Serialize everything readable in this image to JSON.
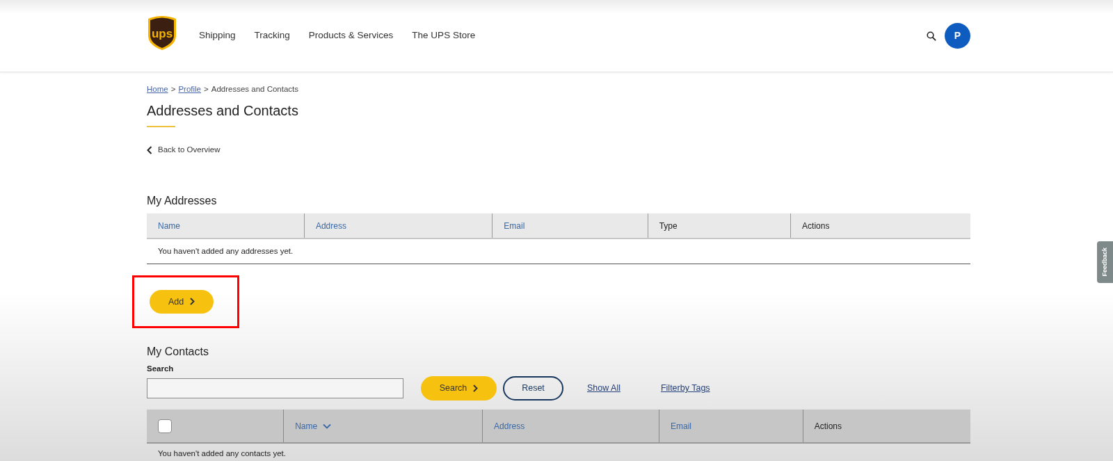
{
  "header": {
    "logo": {
      "text": "ups"
    },
    "nav": [
      "Shipping",
      "Tracking",
      "Products & Services",
      "The UPS Store"
    ],
    "avatar": {
      "initial": "P"
    }
  },
  "breadcrumb": [
    {
      "label": "Home",
      "link": true
    },
    {
      "separator": ">",
      "label": "Profile",
      "link": true
    },
    {
      "separator": ">",
      "label": "Addresses and Contacts",
      "link": false
    }
  ],
  "title": "Addresses and Contacts",
  "back_link": "Back to Overview",
  "addresses": {
    "heading": "My Addresses",
    "columns": [
      {
        "label": "Name",
        "link": true
      },
      {
        "label": "Address",
        "link": true
      },
      {
        "label": "Email",
        "link": true
      },
      {
        "label": "Type",
        "link": false
      },
      {
        "label": "Actions",
        "link": false
      }
    ],
    "empty_text": "You haven't added any addresses yet.",
    "add_button": {
      "label": "Add",
      "highlighted": true
    }
  },
  "contacts": {
    "heading": "My Contacts",
    "search": {
      "label": "Search"
    },
    "search_button": "Search",
    "reset_button": "Reset",
    "show_all": "Show All",
    "filter_link": "Filterby Tags",
    "select_all": {
      "checked": false
    },
    "columns": [
      {
        "label": "Name",
        "link": true,
        "sorted": true
      },
      {
        "label": "Address",
        "link": true,
        "sorted": false
      },
      {
        "label": "Email",
        "link": true,
        "sorted": false
      },
      {
        "label": "Actions",
        "link": false,
        "sorted": false
      }
    ],
    "empty_text": "You haven't added any contacts yet."
  },
  "feedback_tab": "Feedback"
}
